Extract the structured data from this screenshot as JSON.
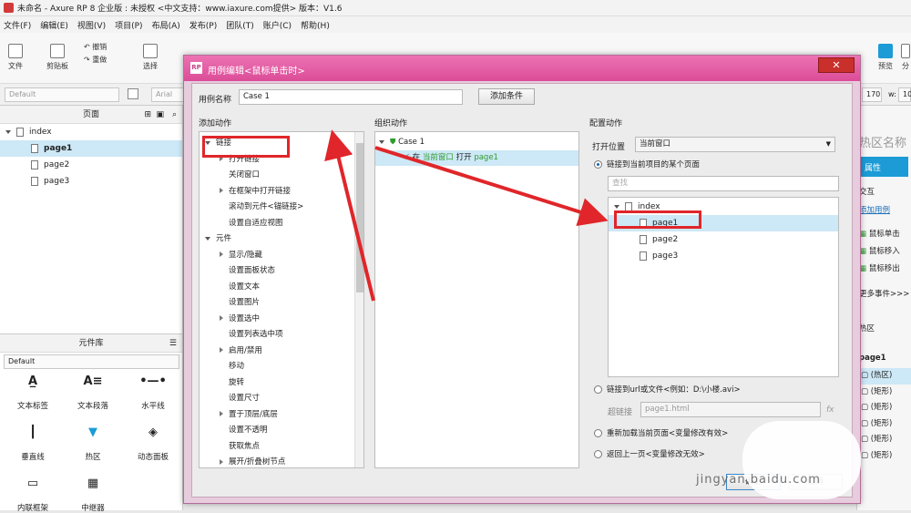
{
  "window": {
    "title": "未命名 - Axure RP 8 企业版 : 未授权    <中文支持：www.iaxure.com提供> 版本：V1.6"
  },
  "menu": [
    "文件(F)",
    "编辑(E)",
    "视图(V)",
    "项目(P)",
    "布局(A)",
    "发布(P)",
    "团队(T)",
    "账户(C)",
    "帮助(H)"
  ],
  "toolbar": {
    "file": "文件",
    "clipboard": "剪贴板",
    "undo": "撤销",
    "redo": "重做",
    "select": "选择",
    "zoom": "100%",
    "preview": "预览",
    "publish": "分"
  },
  "formatbar": {
    "style": "Default",
    "font": "Arial",
    "x": "170",
    "w_label": "w:",
    "w": "10"
  },
  "pages_panel": {
    "title": "页面",
    "items": [
      {
        "label": "index",
        "level": 0
      },
      {
        "label": "page1",
        "level": 1,
        "selected": true
      },
      {
        "label": "page2",
        "level": 1
      },
      {
        "label": "page3",
        "level": 1
      }
    ]
  },
  "widgets_panel": {
    "title": "元件库",
    "library": "Default",
    "items": [
      {
        "label": "文本标签",
        "icon": "A_"
      },
      {
        "label": "文本段落",
        "icon": "A≡"
      },
      {
        "label": "水平线",
        "icon": "—"
      },
      {
        "label": "垂直线",
        "icon": "|"
      },
      {
        "label": "热区",
        "icon": "hotspot"
      },
      {
        "label": "动态面板",
        "icon": "layers"
      },
      {
        "label": "内联框架",
        "icon": "frame"
      },
      {
        "label": "中继器",
        "icon": "grid"
      }
    ]
  },
  "right_panel": {
    "area_name": "热区名称",
    "tab": "属性",
    "interact": "交互",
    "add_case": "添加用例",
    "events": [
      "鼠标单击",
      "鼠标移入",
      "鼠标移出"
    ],
    "more_events": "更多事件>>>",
    "hotspot": "热区",
    "outline_title": "page1",
    "outline_items": [
      "(热区)",
      "(矩形)",
      "(矩形)",
      "(矩形)",
      "(矩形)",
      "(矩形)"
    ]
  },
  "dialog": {
    "title": "用例编辑<鼠标单击时>",
    "case_name_label": "用例名称",
    "case_name_value": "Case 1",
    "add_condition": "添加条件",
    "add_action_title": "添加动作",
    "organize_title": "组织动作",
    "config_title": "配置动作",
    "actions": [
      {
        "label": "链接",
        "level": 0,
        "type": "open"
      },
      {
        "label": "打开链接",
        "level": 1,
        "type": "closed"
      },
      {
        "label": "关闭窗口",
        "level": 1,
        "type": "none"
      },
      {
        "label": "在框架中打开链接",
        "level": 1,
        "type": "closed"
      },
      {
        "label": "滚动到元件<锚链接>",
        "level": 1,
        "type": "none"
      },
      {
        "label": "设置自适应视图",
        "level": 1,
        "type": "none"
      },
      {
        "label": "元件",
        "level": 0,
        "type": "open"
      },
      {
        "label": "显示/隐藏",
        "level": 1,
        "type": "closed"
      },
      {
        "label": "设置面板状态",
        "level": 1,
        "type": "none"
      },
      {
        "label": "设置文本",
        "level": 1,
        "type": "none"
      },
      {
        "label": "设置图片",
        "level": 1,
        "type": "none"
      },
      {
        "label": "设置选中",
        "level": 1,
        "type": "closed"
      },
      {
        "label": "设置列表选中项",
        "level": 1,
        "type": "none"
      },
      {
        "label": "启用/禁用",
        "level": 1,
        "type": "closed"
      },
      {
        "label": "移动",
        "level": 1,
        "type": "none"
      },
      {
        "label": "旋转",
        "level": 1,
        "type": "none"
      },
      {
        "label": "设置尺寸",
        "level": 1,
        "type": "none"
      },
      {
        "label": "置于顶层/底层",
        "level": 1,
        "type": "closed"
      },
      {
        "label": "设置不透明",
        "level": 1,
        "type": "none"
      },
      {
        "label": "获取焦点",
        "level": 1,
        "type": "none"
      },
      {
        "label": "展开/折叠树节点",
        "level": 1,
        "type": "closed"
      }
    ],
    "organize": {
      "case": "Case 1",
      "action_prefix": "在",
      "action_target": "当前窗口",
      "action_verb": "打开",
      "action_page": "page1"
    },
    "config": {
      "open_in_label": "打开位置",
      "open_in_value": "当前窗口",
      "radio_link_page": "链接到当前项目的某个页面",
      "search_placeholder": "查找",
      "tree": [
        {
          "label": "index",
          "level": 0
        },
        {
          "label": "page1",
          "level": 1,
          "selected": true
        },
        {
          "label": "page2",
          "level": 1
        },
        {
          "label": "page3",
          "level": 1
        }
      ],
      "radio_url": "链接到url或文件<例如：D:\\小楼.avi>",
      "hyperlink_label": "超链接",
      "hyperlink_value": "page1.html",
      "fx": "fx",
      "radio_reload": "重新加载当前页面<变量修改有效>",
      "radio_back": "返回上一页<变量修改无效>"
    },
    "ok": "确定",
    "cancel": "取消"
  },
  "watermark": "jingyan.baidu.com",
  "colors": {
    "dialog_title": "#dc4c98",
    "selected_row": "#cde8f6",
    "annotation": "#e0262a",
    "accent": "#1c9bd6"
  }
}
